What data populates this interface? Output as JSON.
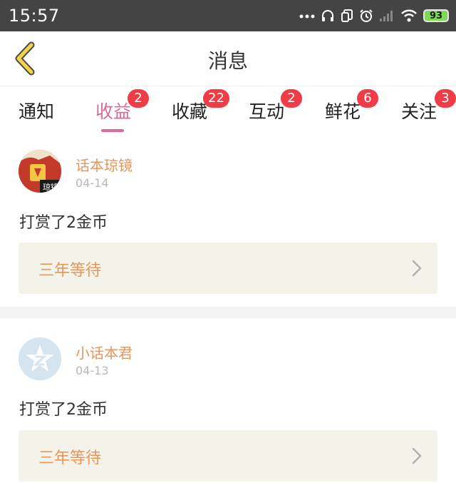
{
  "status_bar": {
    "time": "15:57",
    "battery": "93"
  },
  "header": {
    "title": "消息"
  },
  "tabs": [
    {
      "label": "通知",
      "badge": ""
    },
    {
      "label": "收益",
      "badge": "2",
      "active": true
    },
    {
      "label": "收藏",
      "badge": "22"
    },
    {
      "label": "互动",
      "badge": "2"
    },
    {
      "label": "鲜花",
      "badge": "6"
    },
    {
      "label": "关注",
      "badge": "3"
    }
  ],
  "messages": [
    {
      "username": "话本琼镜",
      "date": "04-14",
      "text": "打赏了2金币",
      "ref_title": "三年等待",
      "avatar_text": "琼镜"
    },
    {
      "username": "小话本君",
      "date": "04-13",
      "text": "打赏了2金币",
      "ref_title": "三年等待"
    }
  ],
  "colors": {
    "accent": "#e0679a",
    "badge": "#f03c47",
    "username": "#e8955a",
    "ref_bg": "#f3f3ea",
    "status_bar": "#444444",
    "back_arrow": "#f2d44c"
  }
}
